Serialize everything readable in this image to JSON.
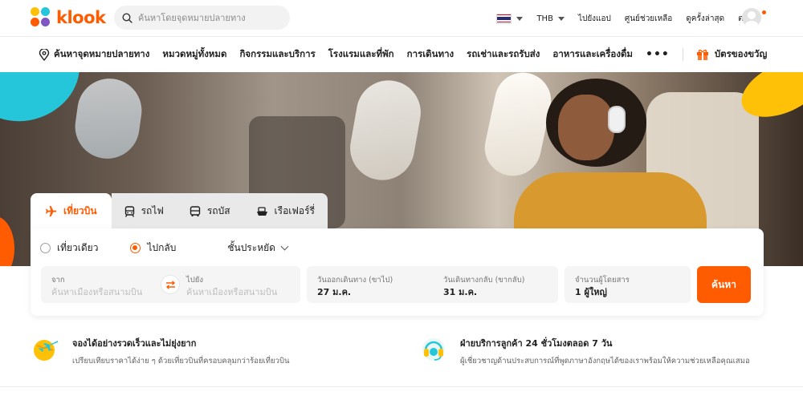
{
  "brand": {
    "name": "klook",
    "color": "#ff5b00"
  },
  "search": {
    "placeholder": "ค้นหาโดยจุดหมายปลายทาง",
    "icon": "search-icon"
  },
  "topbar": {
    "currency": "THB",
    "links": [
      "ไปยังแอป",
      "ศูนย์ช่วยเหลือ",
      "ดูครั้งล่าสุด",
      "ตะกร้า"
    ]
  },
  "categories": {
    "destination": "ค้นหาจุดหมายปลายทาง",
    "items": [
      "หมวดหมู่ทั้งหมด",
      "กิจกรรมและบริการ",
      "โรงแรมและที่พัก",
      "การเดินทาง",
      "รถเช่าและรถรับส่ง",
      "อาหารและเครื่องดื่ม"
    ],
    "more": "•••",
    "gift": "บัตรของขวัญ"
  },
  "booking": {
    "tabs": [
      "เที่ยวบิน",
      "รถไฟ",
      "รถบัส",
      "เรือเฟอร์รี่"
    ],
    "trip_types": [
      "เที่ยวเดียว",
      "ไปกลับ"
    ],
    "selected_trip_type": "ไปกลับ",
    "cabin": "ชั้นประหยัด",
    "from": {
      "label": "จาก",
      "placeholder": "ค้นหาเมืองหรือสนามบิน"
    },
    "to": {
      "label": "ไปยัง",
      "placeholder": "ค้นหาเมืองหรือสนามบิน"
    },
    "depart": {
      "label": "วันออกเดินทาง (ขาไป)",
      "value": "27 ม.ค."
    },
    "return": {
      "label": "วันเดินทางกลับ (ขากลับ)",
      "value": "31 ม.ค."
    },
    "passengers": {
      "label": "จำนวนผู้โดยสาร",
      "value": "1 ผู้ใหญ่"
    },
    "search_button": "ค้นหา"
  },
  "features": [
    {
      "title": "จองได้อย่างรวดเร็วและไม่ยุ่งยาก",
      "desc": "เปรียบเทียบราคาได้ง่าย ๆ ด้วยเที่ยวบินที่ครอบคลุมกว่าร้อยเที่ยวบิน",
      "icon": "airplane-globe-icon"
    },
    {
      "title": "ฝ่ายบริการลูกค้า 24 ชั่วโมงตลอด 7 วัน",
      "desc": "ผู้เชี่ยวชาญด้านประสบการณ์ที่พูดภาษาอังกฤษได้ของเราพร้อมให้ความช่วยเหลือคุณเสมอ",
      "icon": "headset-icon"
    }
  ]
}
